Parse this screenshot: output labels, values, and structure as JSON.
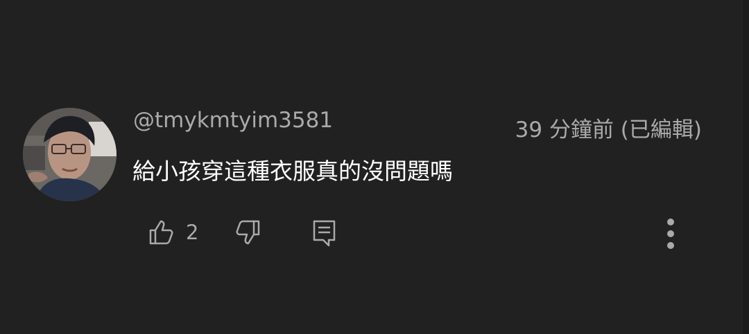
{
  "comment": {
    "username": "@tmykmtyim3581",
    "timestamp": "39 分鐘前 (已編輯)",
    "text": "給小孩穿這種衣服真的沒問題嗎",
    "like_count": "2"
  },
  "icons": {
    "like": "thumb-up-icon",
    "dislike": "thumb-down-icon",
    "reply": "reply-comment-icon",
    "more": "more-vertical-icon"
  },
  "colors": {
    "background": "#212121",
    "primary_text": "#ffffff",
    "secondary_text": "#aaaaaa"
  }
}
